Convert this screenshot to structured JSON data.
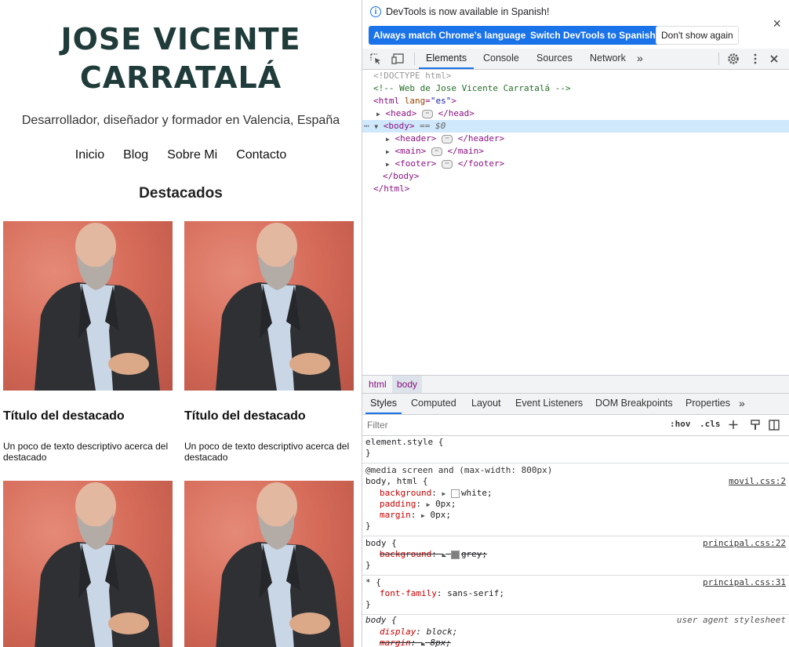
{
  "site": {
    "title_line1": "JOSE VICENTE",
    "title_line2": "CARRATALÁ",
    "tagline": "Desarrollador, diseñador y formador en Valencia, España",
    "nav": [
      "Inicio",
      "Blog",
      "Sobre Mi",
      "Contacto"
    ],
    "section_title": "Destacados",
    "cards": [
      {
        "title": "Título del destacado",
        "text": "Un poco de texto descriptivo acerca del destacado"
      },
      {
        "title": "Título del destacado",
        "text": "Un poco de texto descriptivo acerca del destacado"
      },
      {
        "title": "",
        "text": ""
      },
      {
        "title": "",
        "text": ""
      }
    ]
  },
  "devtools": {
    "infobar": {
      "message": "DevTools is now available in Spanish!",
      "buttons": [
        "Always match Chrome's language",
        "Switch DevTools to Spanish",
        "Don't show again"
      ],
      "close": "×"
    },
    "tabs": [
      "Elements",
      "Console",
      "Sources",
      "Network",
      "»"
    ],
    "dom": {
      "doctype": "<!DOCTYPE html>",
      "comment": "<!-- Web de Jose Vicente Carratalá -->",
      "html_open_tag": "<html",
      "html_attr": "lang",
      "html_attr_value": "\"es\"",
      "html_open_close": ">",
      "head_open": "<head>",
      "head_close": "</head>",
      "body_open": "<body>",
      "body_suffix": "== $0",
      "header_open": "<header>",
      "header_close": "</header>",
      "main_open": "<main>",
      "main_close": "</main>",
      "footer_open": "<footer>",
      "footer_close": "</footer>",
      "body_close": "</body>",
      "html_close": "</html>"
    },
    "breadcrumbs": [
      "html",
      "body"
    ],
    "style_tabs": [
      "Styles",
      "Computed",
      "Layout",
      "Event Listeners",
      "DOM Breakpoints",
      "Properties",
      "»"
    ],
    "filter_placeholder": "Filter",
    "filter_buttons": [
      ":hov",
      ".cls"
    ],
    "rules": {
      "element_style": "element.style {",
      "close": "}",
      "media": "@media screen and (max-width: 800px)",
      "r1_selector": "body, html {",
      "r1_source": "movil.css:2",
      "r1_props": [
        {
          "name": "background",
          "value": "white;"
        },
        {
          "name": "padding",
          "value": "0px;"
        },
        {
          "name": "margin",
          "value": "0px;"
        }
      ],
      "r2_selector": "body {",
      "r2_source": "principal.css:22",
      "r2_prop": {
        "name": "background",
        "value": "grey;"
      },
      "r3_selector": "* {",
      "r3_source": "principal.css:31",
      "r3_prop": {
        "name": "font-family",
        "value": "sans-serif;"
      },
      "r4_selector": "body {",
      "r4_source": "user agent stylesheet",
      "r4_props": [
        {
          "name": "display",
          "value": "block;"
        },
        {
          "name": "margin",
          "value": "8px;"
        }
      ]
    },
    "colors": {
      "accent": "#1a73e8",
      "tag": "#881280",
      "selection": "#cfe8fc"
    }
  }
}
